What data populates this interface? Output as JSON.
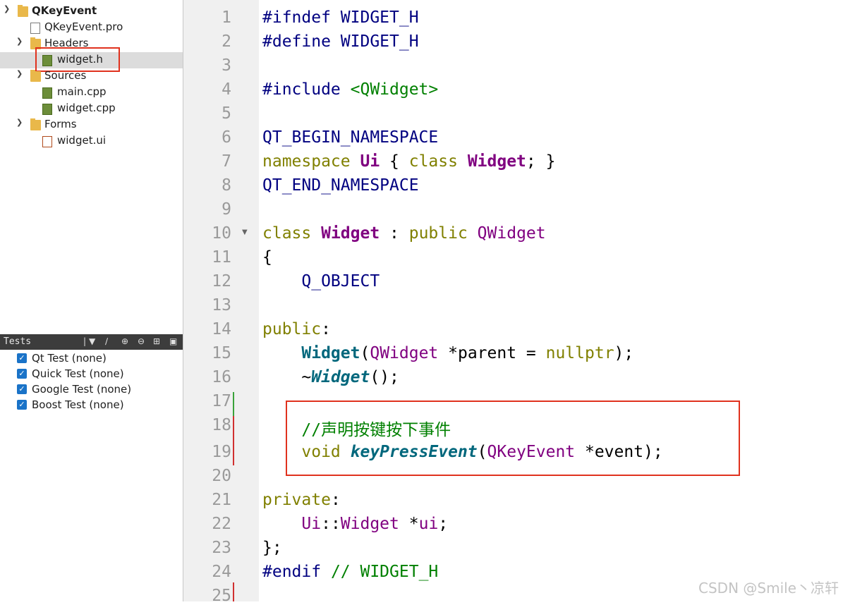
{
  "project_tree": {
    "project": "QKeyEvent",
    "pro_file": "QKeyEvent.pro",
    "headers_folder": "Headers",
    "header_file": "widget.h",
    "sources_folder": "Sources",
    "source_files": [
      "main.cpp",
      "widget.cpp"
    ],
    "forms_folder": "Forms",
    "form_file": "widget.ui"
  },
  "tests": {
    "title": "Tests",
    "items": [
      "Qt Test (none)",
      "Quick Test (none)",
      "Google Test (none)",
      "Boost Test (none)"
    ]
  },
  "editor": {
    "line_numbers": [
      "1",
      "2",
      "3",
      "4",
      "5",
      "6",
      "7",
      "8",
      "9",
      "10",
      "11",
      "12",
      "13",
      "14",
      "15",
      "16",
      "17",
      "18",
      "19",
      "20",
      "21",
      "22",
      "23",
      "24",
      "25"
    ],
    "lines": {
      "l1_a": "#ifndef",
      "l1_b": " WIDGET_H",
      "l2_a": "#define",
      "l2_b": " WIDGET_H",
      "l4_a": "#include",
      "l4_b": " <QWidget>",
      "l6": "QT_BEGIN_NAMESPACE",
      "l7_a": "namespace",
      "l7_b": " Ui",
      "l7_c": " {",
      "l7_d": " class",
      "l7_e": " Widget",
      "l7_f": "; }",
      "l8": "QT_END_NAMESPACE",
      "l10_a": "class",
      "l10_b": " Widget",
      "l10_c": " :",
      "l10_d": " public",
      "l10_e": " QWidget",
      "l11": "{",
      "l12": "    Q_OBJECT",
      "l14_a": "public",
      "l14_b": ":",
      "l15_a": "    ",
      "l15_b": "Widget",
      "l15_c": "(",
      "l15_d": "QWidget",
      "l15_e": " *parent = ",
      "l15_f": "nullptr",
      "l15_g": ");",
      "l16_a": "    ~",
      "l16_b": "Widget",
      "l16_c": "();",
      "l18": "    //声明按键按下事件",
      "l19_a": "    ",
      "l19_b": "void",
      "l19_c": " ",
      "l19_d": "keyPressEvent",
      "l19_e": "(",
      "l19_f": "QKeyEvent",
      "l19_g": " *event);",
      "l21_a": "private",
      "l21_b": ":",
      "l22_a": "    ",
      "l22_b": "Ui",
      "l22_c": "::",
      "l22_d": "Widget",
      "l22_e": " *",
      "l22_f": "ui",
      "l22_g": ";",
      "l23": "};",
      "l24_a": "#endif",
      "l24_b": " // WIDGET_H"
    }
  },
  "watermark": "CSDN @Smile丶凉轩",
  "colors": {
    "keyword": "#808000",
    "type": "#800080",
    "function": "#00677c",
    "comment": "#008000",
    "highlight_border": "#e0321e"
  }
}
